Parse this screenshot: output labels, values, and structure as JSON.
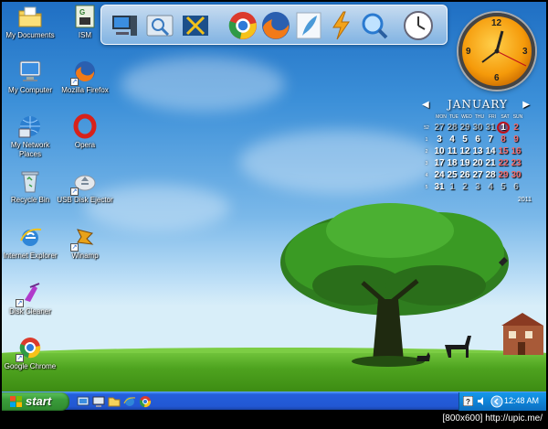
{
  "desktop_icons": [
    {
      "label": "My Documents",
      "icon": "folder-documents-icon"
    },
    {
      "label": "My Computer",
      "icon": "computer-icon"
    },
    {
      "label": "My Network Places",
      "icon": "network-icon"
    },
    {
      "label": "Recycle Bin",
      "icon": "recycle-bin-icon"
    },
    {
      "label": "Internet Explorer",
      "icon": "internet-explorer-icon"
    },
    {
      "label": "Disk Cleaner",
      "icon": "disk-cleaner-icon"
    },
    {
      "label": "Google Chrome",
      "icon": "chrome-icon"
    },
    {
      "label": "ISM",
      "icon": "ism-icon"
    },
    {
      "label": "Mozilla Firefox",
      "icon": "firefox-icon"
    },
    {
      "label": "Opera",
      "icon": "opera-icon"
    },
    {
      "label": "USB Disk Ejector",
      "icon": "usb-eject-icon"
    },
    {
      "label": "Winamp",
      "icon": "winamp-icon"
    }
  ],
  "dock": {
    "items": [
      "computer-icon",
      "search-folder-icon",
      "tools-icon",
      "chrome-icon",
      "firefox-icon",
      "feather-icon",
      "lightning-icon",
      "magnifier-icon",
      "clock-icon"
    ]
  },
  "clock_widget": {
    "numbers": [
      "12",
      "3",
      "6",
      "9"
    ]
  },
  "calendar": {
    "month": "JANUARY",
    "days_of_week": [
      "MON",
      "TUE",
      "WED",
      "THU",
      "FRI",
      "SAT",
      "SUN"
    ],
    "weeks": [
      {
        "wk": "52",
        "days": [
          "27",
          "28",
          "29",
          "30",
          "31",
          "1",
          "2"
        ]
      },
      {
        "wk": "1",
        "days": [
          "3",
          "4",
          "5",
          "6",
          "7",
          "8",
          "9"
        ]
      },
      {
        "wk": "2",
        "days": [
          "10",
          "11",
          "12",
          "13",
          "14",
          "15",
          "16"
        ]
      },
      {
        "wk": "3",
        "days": [
          "17",
          "18",
          "19",
          "20",
          "21",
          "22",
          "23"
        ]
      },
      {
        "wk": "4",
        "days": [
          "24",
          "25",
          "26",
          "27",
          "28",
          "29",
          "30"
        ]
      },
      {
        "wk": "5",
        "days": [
          "31",
          "1",
          "2",
          "3",
          "4",
          "5",
          "6"
        ]
      }
    ],
    "today": "1",
    "year": "2011"
  },
  "taskbar": {
    "start_label": "start",
    "quick_launch": [
      "show-desktop-icon",
      "computer-icon",
      "folder-icon",
      "internet-explorer-icon",
      "chrome-icon"
    ],
    "clock": "12:48 AM"
  },
  "watermark": "[800x600] http://upic.me/",
  "colors": {
    "taskbar": "#245edb",
    "start": "#3a9c3a",
    "tray": "#0f84d8",
    "calendar_weekend": "#f26b6b",
    "today_ring": "#c0101a"
  }
}
